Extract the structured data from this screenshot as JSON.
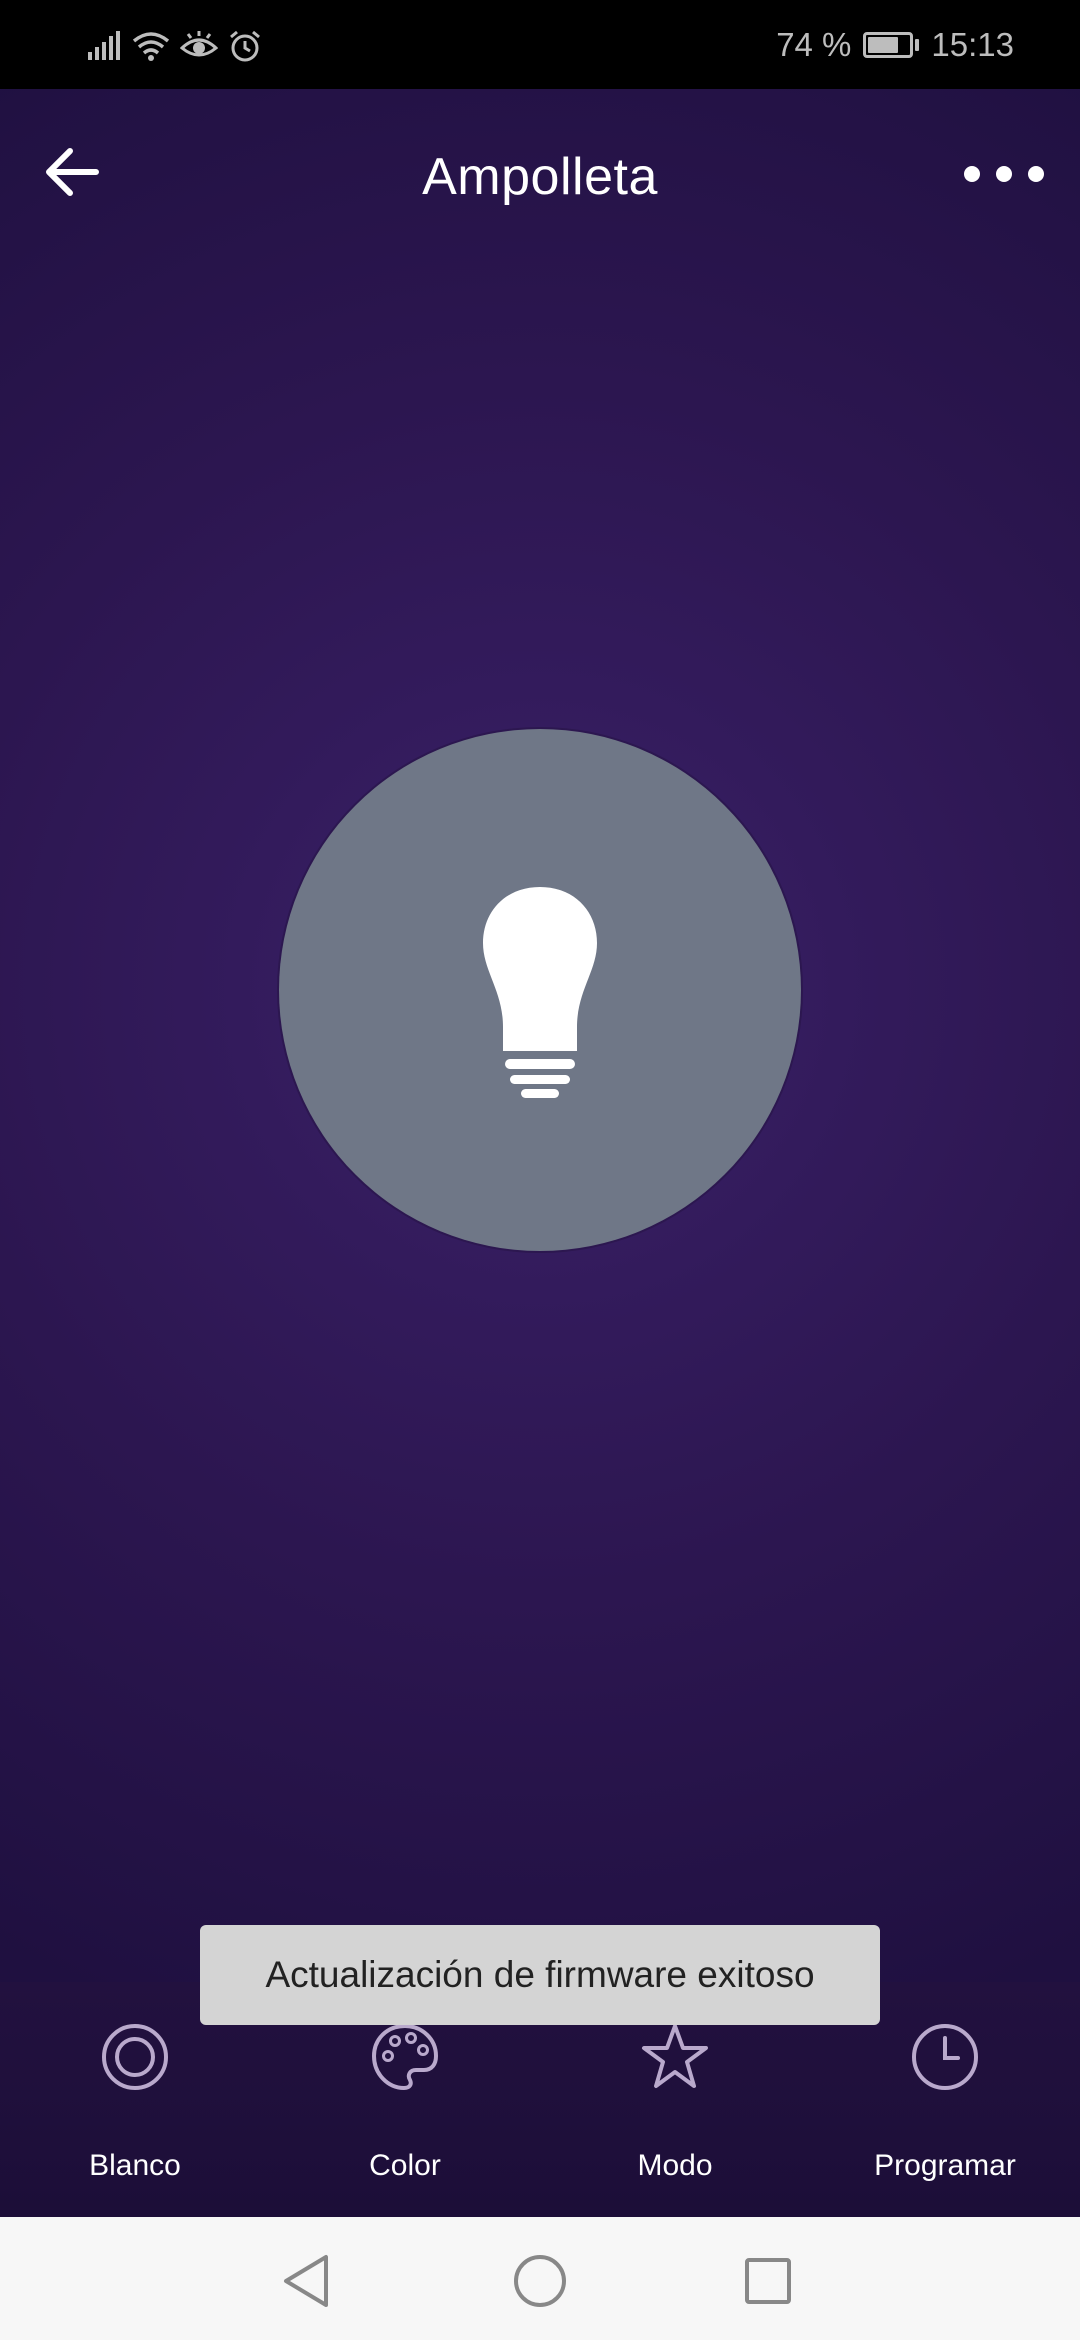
{
  "status_bar": {
    "battery_percent_text": "74 %",
    "battery_level": 0.74,
    "time": "15:13",
    "icons": [
      "signal-icon",
      "wifi-icon",
      "eye-comfort-icon",
      "alarm-icon",
      "battery-icon"
    ]
  },
  "header": {
    "title": "Ampolleta",
    "back_icon": "arrow-left-icon",
    "more_icon": "more-dots-icon"
  },
  "bulb": {
    "icon": "lightbulb-icon",
    "circle_color": "#6f7787",
    "state": "off"
  },
  "tabs": [
    {
      "label": "Blanco",
      "icon": "ring-icon"
    },
    {
      "label": "Color",
      "icon": "palette-icon"
    },
    {
      "label": "Modo",
      "icon": "star-icon"
    },
    {
      "label": "Programar",
      "icon": "clock-icon"
    }
  ],
  "toast": {
    "message": "Actualización de firmware exitoso"
  },
  "nav": {
    "icons": [
      "nav-back-icon",
      "nav-home-icon",
      "nav-recents-icon"
    ]
  },
  "colors": {
    "background": "#2c1650",
    "accent_icon": "#b9a9cc",
    "toast_bg": "#d4d4d4"
  }
}
